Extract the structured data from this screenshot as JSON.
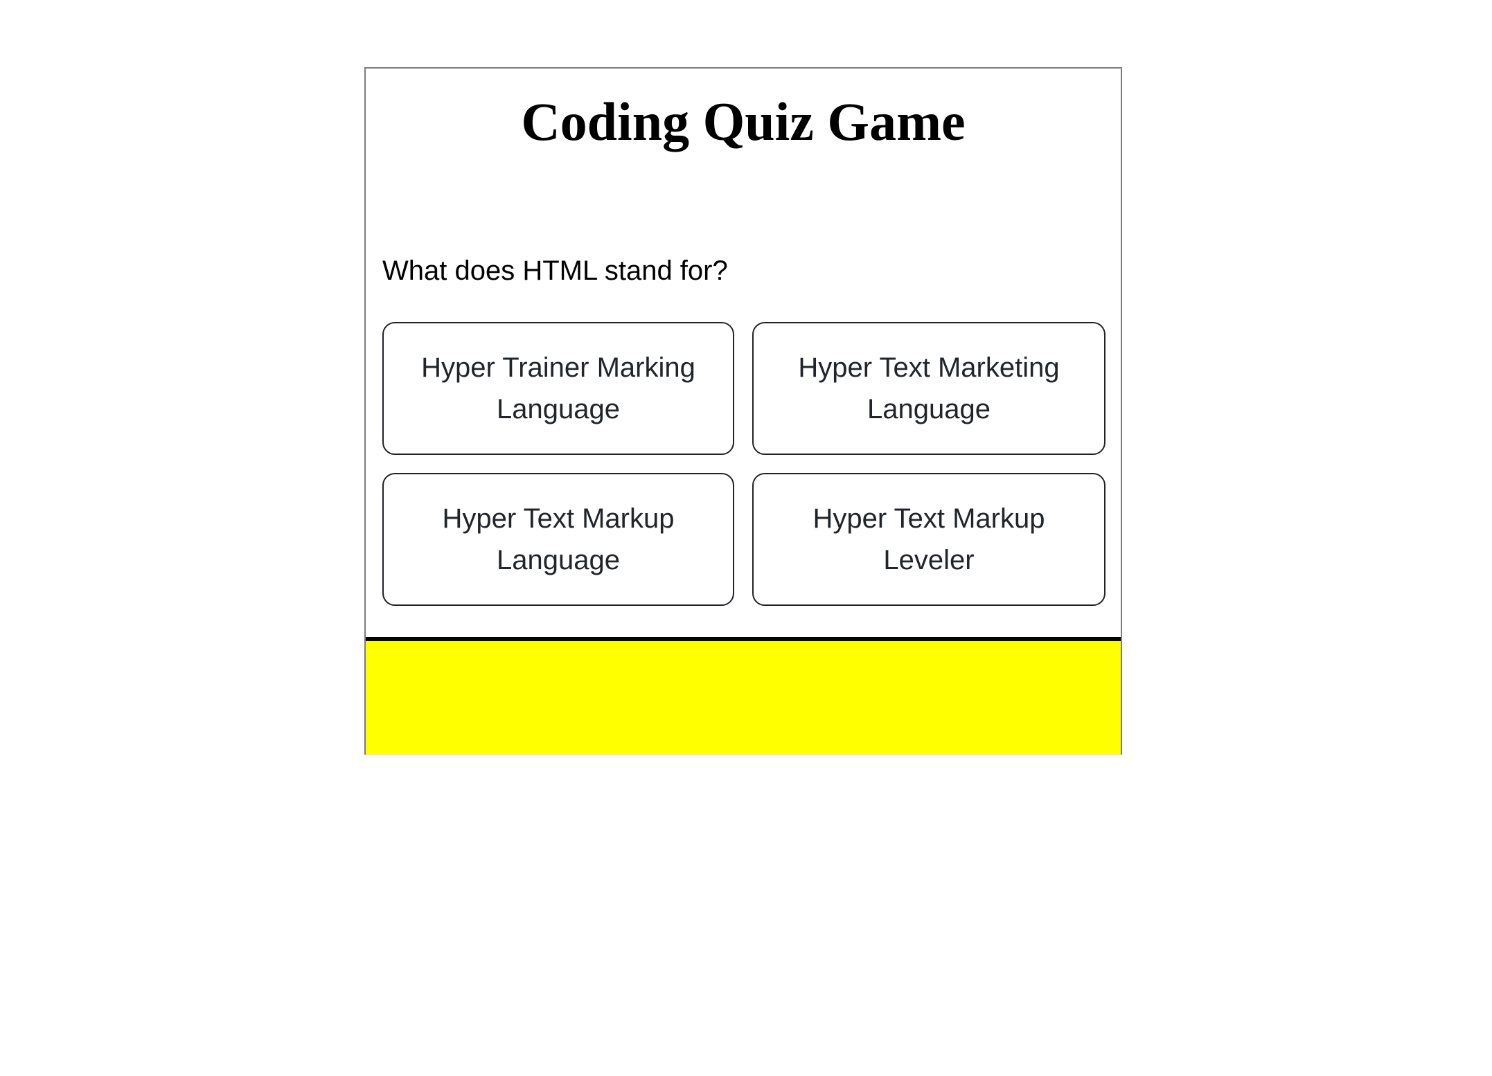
{
  "page": {
    "title": "Coding Quiz Game"
  },
  "quiz": {
    "question": "What does HTML stand for?",
    "answers": [
      "Hyper Trainer Marking Language",
      "Hyper Text Marketing Language",
      "Hyper Text Markup Language",
      "Hyper Text Markup Leveler"
    ]
  },
  "colors": {
    "feedback_panel": "#ffff00",
    "card_border": "#7b7b84",
    "button_border": "#1f2328"
  }
}
